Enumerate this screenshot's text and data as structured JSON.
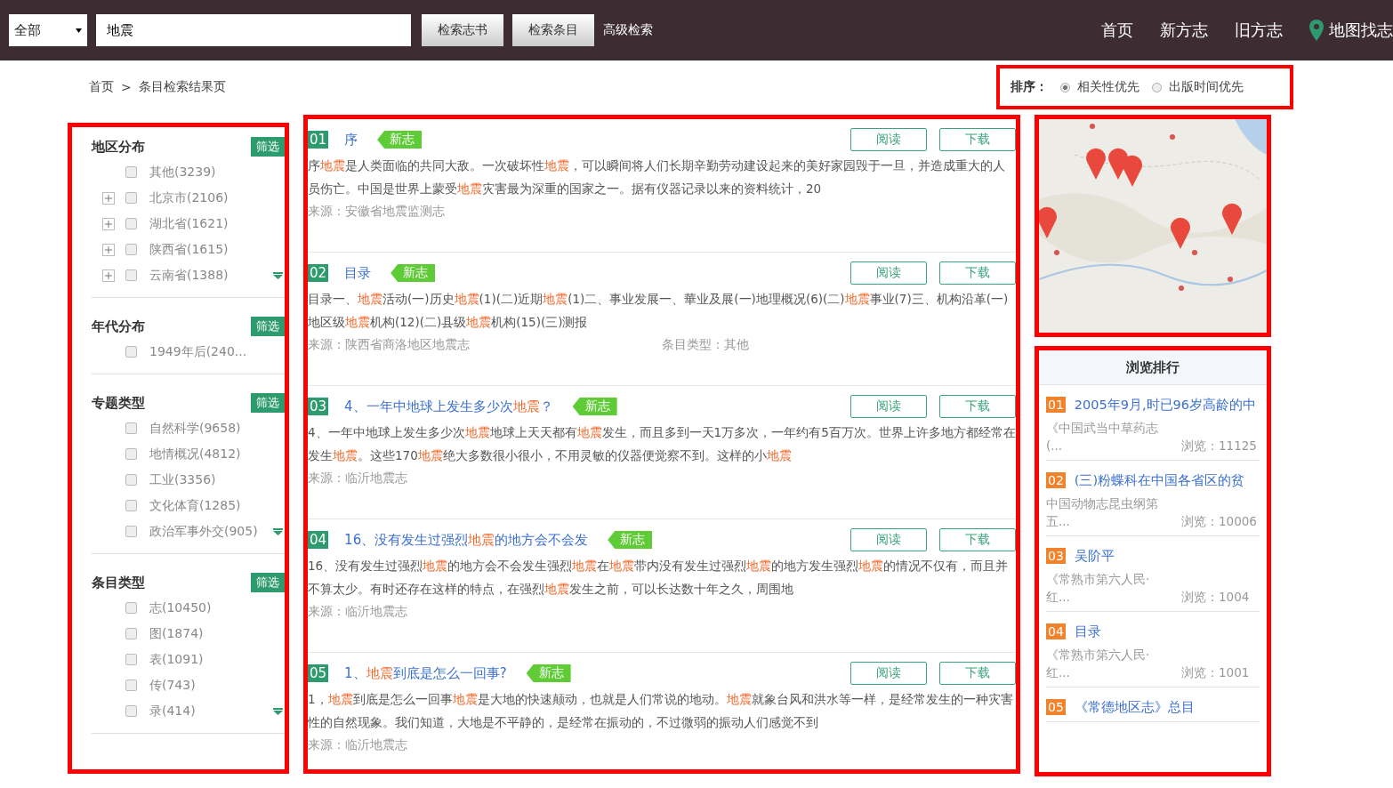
{
  "header": {
    "scope": "全部",
    "query": "地震",
    "buttons": [
      "检索志书",
      "检索条目"
    ],
    "advanced": "高级检索",
    "nav": [
      {
        "label": "首页",
        "kind": "text"
      },
      {
        "label": "新方志",
        "kind": "text"
      },
      {
        "label": "旧方志",
        "kind": "text"
      },
      {
        "label": "地图找志",
        "kind": "map"
      }
    ]
  },
  "breadcrumb": {
    "home": "首页",
    "separator": ">",
    "current": "条目检索结果页"
  },
  "sort": {
    "label": "排序：",
    "options": [
      {
        "label": "相关性优先",
        "selected": true
      },
      {
        "label": "出版时间优先",
        "selected": false
      }
    ]
  },
  "filters": [
    {
      "title": "地区分布",
      "button": "筛选",
      "has_more": true,
      "items": [
        {
          "label": "其他(3239)",
          "checked": false,
          "expandable": false
        },
        {
          "label": "北京市(2106)",
          "checked": false,
          "expandable": true
        },
        {
          "label": "湖北省(1621)",
          "checked": false,
          "expandable": true
        },
        {
          "label": "陕西省(1615)",
          "checked": false,
          "expandable": true
        },
        {
          "label": "云南省(1388)",
          "checked": false,
          "expandable": true
        }
      ]
    },
    {
      "title": "年代分布",
      "button": "筛选",
      "has_more": false,
      "items": [
        {
          "label": "1949年后(240...",
          "checked": false,
          "expandable": false
        }
      ]
    },
    {
      "title": "专题类型",
      "button": "筛选",
      "has_more": true,
      "items": [
        {
          "label": "自然科学(9658)",
          "checked": false,
          "expandable": false
        },
        {
          "label": "地情概况(4812)",
          "checked": false,
          "expandable": false
        },
        {
          "label": "工业(3356)",
          "checked": false,
          "expandable": false
        },
        {
          "label": "文化体育(1285)",
          "checked": false,
          "expandable": false
        },
        {
          "label": "政治军事外交(905)",
          "checked": false,
          "expandable": false
        }
      ]
    },
    {
      "title": "条目类型",
      "button": "筛选",
      "has_more": true,
      "items": [
        {
          "label": "志(10450)",
          "checked": false,
          "expandable": false
        },
        {
          "label": "图(1874)",
          "checked": false,
          "expandable": false
        },
        {
          "label": "表(1091)",
          "checked": false,
          "expandable": false
        },
        {
          "label": "传(743)",
          "checked": false,
          "expandable": false
        },
        {
          "label": "录(414)",
          "checked": false,
          "expandable": false
        }
      ]
    }
  ],
  "results": [
    {
      "number": "01",
      "title": "序",
      "tag": "新志",
      "actions": [
        "阅读",
        "下载"
      ],
      "snippet": "序**地震**是人类面临的共同大敌。一次破坏性**地震**，可以瞬间将人们长期辛勤劳动建设起来的美好家园毁于一旦，并造成重大的人员伤亡。中国是世界上蒙受**地震**灾害最为深重的国家之一。据有仪器记录以来的资料统计，20",
      "source": "来源：安徽省地震监测志"
    },
    {
      "number": "02",
      "title": "目录",
      "tag": "新志",
      "actions": [
        "阅读",
        "下载"
      ],
      "snippet": "目录一、**地震**活动(一)历史**地震**(1)(二)近期**地震**(1)二、事业发展一、華业及展(一)地理概况(6)(二)**地震**事业(7)三、机构沿革(一)地区级**地震**机构(12)(二)县级**地震**机构(15)(三)测报",
      "source": "来源：陕西省商洛地区地震志",
      "type": "条目类型：其他"
    },
    {
      "number": "03",
      "title": "4、一年中地球上发生多少次**地震**？",
      "tag": "新志",
      "actions": [
        "阅读",
        "下载"
      ],
      "snippet": "4、一年中地球上发生多少次**地震**地球上天天都有**地震**发生，而且多到一天1万多次，一年约有5百万次。世界上许多地方都经常在发生**地震**。这些170**地震**绝大多数很小很小，不用灵敏的仪器便觉察不到。这样的小**地震**",
      "source": "来源：临沂地震志"
    },
    {
      "number": "04",
      "title": "16、没有发生过强烈**地震**的地方会不会发",
      "tag": "新志",
      "actions": [
        "阅读",
        "下载"
      ],
      "snippet": "16、没有发生过强烈**地震**的地方会不会发生强烈**地震**在**地震**带内没有发生过强烈**地震**的地方发生强烈**地震**的情况不仅有，而且并不算太少。有时还存在这样的特点，在强烈**地震**发生之前，可以长达数十年之久，周围地",
      "source": "来源：临沂地震志"
    },
    {
      "number": "05",
      "title": "1、**地震**到底是怎么一回事?",
      "tag": "新志",
      "actions": [
        "阅读",
        "下载"
      ],
      "snippet": "1，**地震**到底是怎么一回事**地震**是大地的快速颠动，也就是人们常说的地动。**地震**就象台风和洪水等一样，是经常发生的一种灾害性的自然现象。我们知道，大地是不平静的，是经常在振动的，不过微弱的振动人们感觉不到",
      "source": "来源：临沂地震志"
    }
  ],
  "ranking": {
    "title": "浏览排行",
    "items": [
      {
        "number": "01",
        "title": "2005年9月,时已96岁高龄的中",
        "source": "《中国武当中草药志(...",
        "views": "浏览：11125"
      },
      {
        "number": "02",
        "title": "(三)粉蝶科在中国各省区的贫",
        "source": "中国动物志昆虫纲第五...",
        "views": "浏览：10006"
      },
      {
        "number": "03",
        "title": "吴阶平",
        "source": "《常熟市第六人民·红...",
        "views": "浏览：1004"
      },
      {
        "number": "04",
        "title": "目录",
        "source": "《常熟市第六人民·红...",
        "views": "浏览：1001"
      },
      {
        "number": "05",
        "title": "《常德地区志》总目"
      }
    ]
  }
}
